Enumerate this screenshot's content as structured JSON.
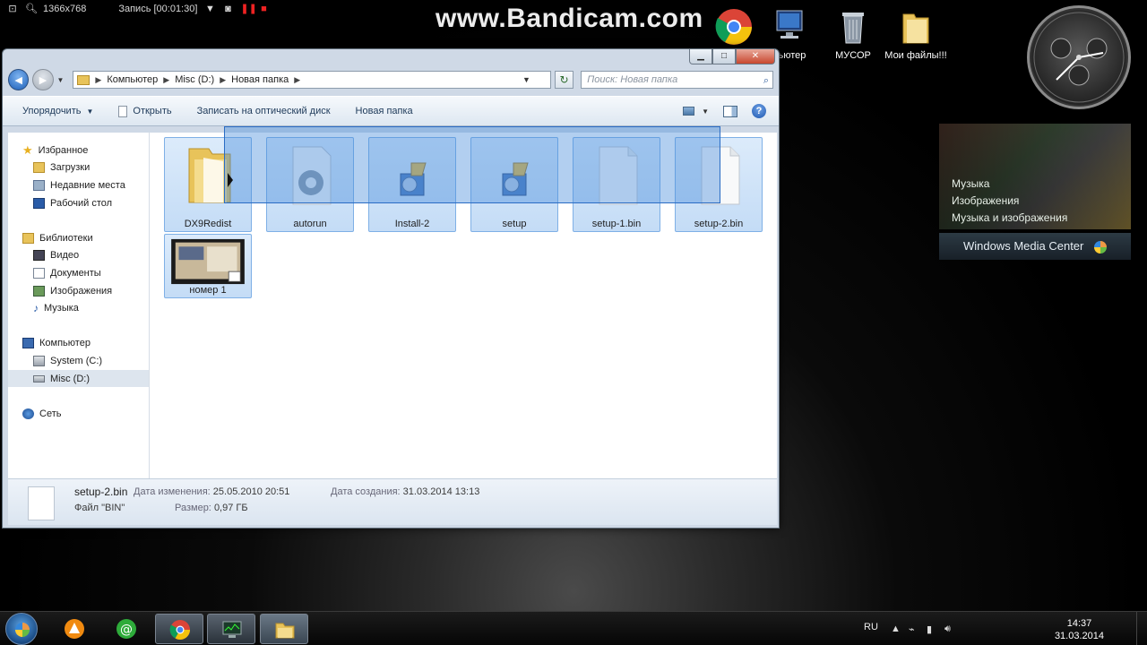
{
  "recorder": {
    "resolution": "1366x768",
    "status": "Запись [00:01:30]"
  },
  "watermark": "www.Bandicam.com",
  "desktop": {
    "icons": [
      {
        "label": "пьютер",
        "icon": "computer-icon"
      },
      {
        "label": "МУСОР",
        "icon": "recycle-bin-icon"
      },
      {
        "label": "Мои файлы!!!",
        "icon": "folder-icon"
      }
    ]
  },
  "media_center": {
    "menu": [
      "Музыка",
      "Изображения",
      "Музыка и изображения"
    ],
    "brand": "Windows Media Center"
  },
  "window": {
    "breadcrumb": [
      "Компьютер",
      "Misc (D:)",
      "Новая папка"
    ],
    "search_placeholder": "Поиск: Новая папка",
    "toolbar": {
      "organize": "Упорядочить",
      "open": "Открыть",
      "burn": "Записать на оптический диск",
      "new_folder": "Новая папка"
    },
    "nav": {
      "favorites": "Избранное",
      "downloads": "Загрузки",
      "recent": "Недавние места",
      "desktop": "Рабочий стол",
      "libraries": "Библиотеки",
      "video": "Видео",
      "documents": "Документы",
      "images": "Изображения",
      "music": "Музыка",
      "computer": "Компьютер",
      "system_c": "System (C:)",
      "misc_d": "Misc (D:)",
      "network": "Сеть"
    },
    "files": [
      {
        "name": "DX9Redist",
        "type": "folder"
      },
      {
        "name": "autorun",
        "type": "settings"
      },
      {
        "name": "Install-2",
        "type": "installer"
      },
      {
        "name": "setup",
        "type": "installer"
      },
      {
        "name": "setup-1.bin",
        "type": "blank"
      },
      {
        "name": "setup-2.bin",
        "type": "blank"
      },
      {
        "name": "номер 1",
        "type": "video"
      }
    ],
    "details": {
      "name": "setup-2.bin",
      "modified_label": "Дата изменения:",
      "modified": "25.05.2010 20:51",
      "created_label": "Дата создания:",
      "created": "31.03.2014 13:13",
      "type": "Файл \"BIN\"",
      "size_label": "Размер:",
      "size": "0,97 ГБ"
    }
  },
  "taskbar": {
    "lang": "RU",
    "time": "14:37",
    "date": "31.03.2014"
  }
}
